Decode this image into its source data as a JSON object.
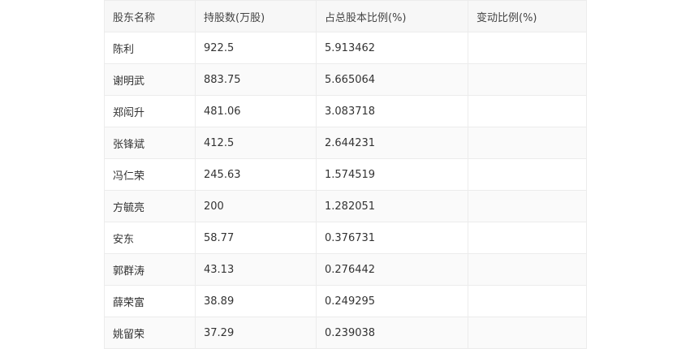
{
  "table": {
    "headers": [
      "股东名称",
      "持股数(万股)",
      "占总股本比例(%)",
      "变动比例(%)"
    ],
    "rows": [
      [
        "陈利",
        "922.5",
        "5.913462",
        ""
      ],
      [
        "谢明武",
        "883.75",
        "5.665064",
        ""
      ],
      [
        "郑闳升",
        "481.06",
        "3.083718",
        ""
      ],
      [
        "张锋斌",
        "412.5",
        "2.644231",
        ""
      ],
      [
        "冯仁荣",
        "245.63",
        "1.574519",
        ""
      ],
      [
        "方毓亮",
        "200",
        "1.282051",
        ""
      ],
      [
        "安东",
        "58.77",
        "0.376731",
        ""
      ],
      [
        "郭群涛",
        "43.13",
        "0.276442",
        ""
      ],
      [
        "薛荣富",
        "38.89",
        "0.249295",
        ""
      ],
      [
        "姚留荣",
        "37.29",
        "0.239038",
        ""
      ]
    ]
  }
}
